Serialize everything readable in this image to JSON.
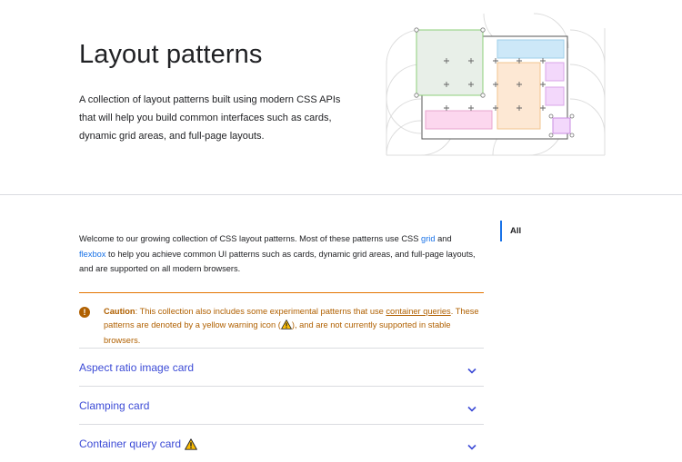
{
  "hero": {
    "title": "Layout patterns",
    "description": "A collection of layout patterns built using modern CSS APIs that will help you build common interfaces such as cards, dynamic grid areas, and full-page layouts."
  },
  "intro": {
    "text_before_grid": "Welcome to our growing collection of CSS layout patterns. Most of these patterns use CSS ",
    "grid_link": "grid",
    "text_and": " and ",
    "flexbox_link": "flexbox",
    "text_after": " to help you achieve common UI patterns such as cards, dynamic grid areas, and full-page layouts, and are supported on all modern browsers."
  },
  "caution": {
    "label": "Caution",
    "text_before": ": This collection also includes some experimental patterns that use ",
    "link": "container queries",
    "text_middle": ". These patterns are denoted by a yellow warning icon (",
    "text_after": "), and are not currently supported in stable browsers.",
    "icon": "exclamation-circle-icon"
  },
  "accordion": {
    "items": [
      {
        "title": "Aspect ratio image card",
        "warning": false
      },
      {
        "title": "Clamping card",
        "warning": false
      },
      {
        "title": "Container query card",
        "warning": true
      }
    ]
  },
  "side_nav": {
    "items": [
      {
        "label": "All"
      }
    ]
  },
  "colors": {
    "accent": "#1a73e8",
    "link": "#3c4bd6",
    "caution": "#b06000",
    "caution_rule": "#e37400",
    "warning_yellow": "#fbbc04"
  }
}
